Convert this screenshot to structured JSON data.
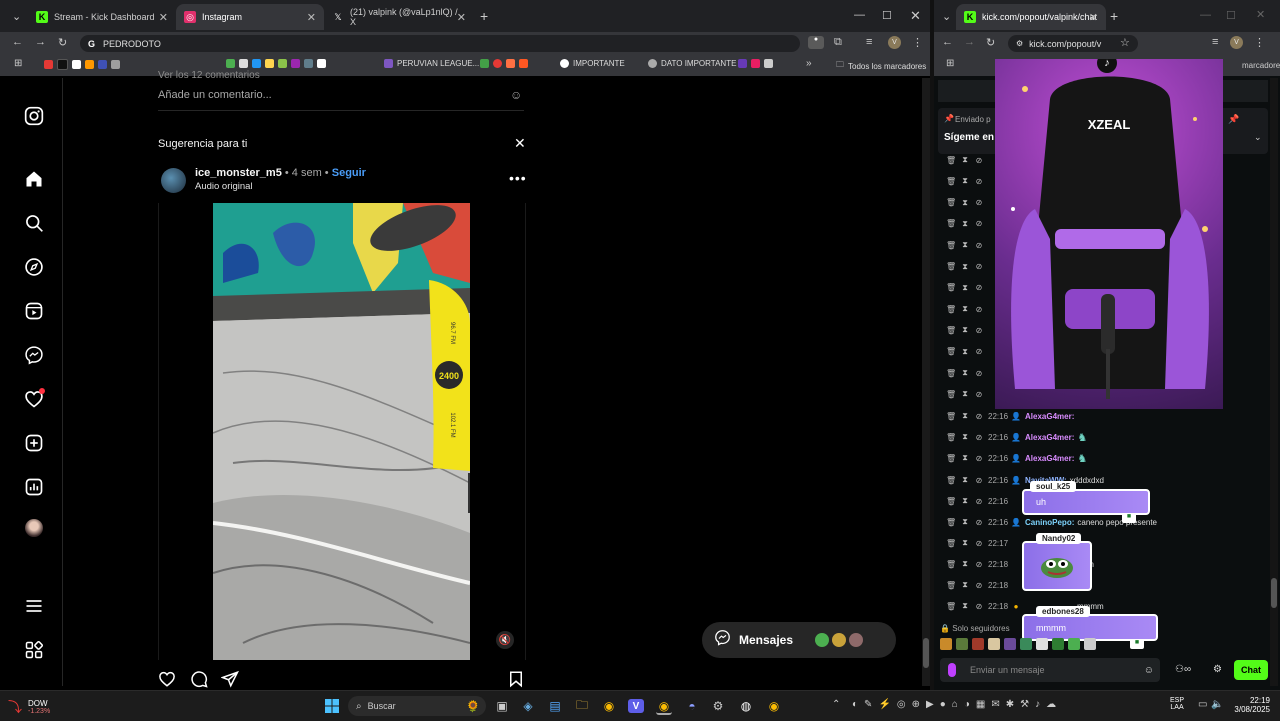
{
  "left_window": {
    "tabs": [
      {
        "label": "Stream - Kick Dashboard",
        "fav_color": "#53fc18",
        "fav": "K"
      },
      {
        "label": "Instagram",
        "fav_color": "#e1306c",
        "fav": "◎"
      },
      {
        "label": "(21) valpink (@vaLp1nlQ) / X",
        "fav_color": "#ffffff",
        "fav": "𝕏"
      }
    ],
    "address": "PEDRODOTO",
    "bookmarks": {
      "peruvian": "PERUVIAN LEAGUE...",
      "importante": "IMPORTANTE",
      "dato": "DATO IMPORTANTE",
      "all": "Todos los marcadores"
    }
  },
  "right_window": {
    "tab_label": "kick.com/popout/valpink/chat",
    "address": "kick.com/popout/v",
    "bookmark_tail": "marcadores"
  },
  "instagram": {
    "comment_count_partial": "Ver los 12 comentarios",
    "comment_placeholder": "Añade un comentario...",
    "suggestion_title": "Sugerencia para ti",
    "username": "ice_monster_m5",
    "time": "• 4 sem •",
    "follow": "Seguir",
    "audio": "Audio original",
    "messages": "Mensajes",
    "banner_text_1": "96.7 FM",
    "banner_text_2": "102.1 FM"
  },
  "chat": {
    "pinned_label": "Enviado p",
    "pinned_text": "Sígeme en",
    "rows": [
      {
        "time": "22:16",
        "user": "AlexaG4mer:",
        "color": "#d98cff",
        "msg": ""
      },
      {
        "time": "22:16",
        "user": "AlexaG4mer:",
        "color": "#d98cff",
        "msg": ""
      },
      {
        "time": "22:16",
        "user": "NayitaWW:",
        "color": "#8fb4ff",
        "msg": "xdddxdxd"
      },
      {
        "time": "22:16",
        "user": "",
        "color": "#ffffff",
        "msg": ""
      },
      {
        "time": "22:16",
        "user": "CaninoPepo:",
        "color": "#7dd3fc",
        "msg": "caneno pepo presente"
      },
      {
        "time": "22:17",
        "user": "",
        "color": "#ffffff",
        "msg": ""
      },
      {
        "time": "22:18",
        "user": "",
        "color": "#ffffff",
        "msg": "uh"
      },
      {
        "time": "22:18",
        "user": "",
        "color": "#ffffff",
        "msg": ""
      },
      {
        "time": "22:18",
        "user": "",
        "color": "#ffffff",
        "msg": "mmmm"
      }
    ],
    "alerts": [
      {
        "name": "soul_k25",
        "msg": "uh"
      },
      {
        "name": "Nandy02",
        "msg": ""
      },
      {
        "name": "edbones28",
        "msg": "mmmm"
      }
    ],
    "followers_only": "Solo seguidores",
    "input_placeholder": "Enviar un mensaje",
    "chat_button": "Chat",
    "chair_brand": "XZEAL"
  },
  "taskbar": {
    "ticker_name": "DOW",
    "ticker_value": "-1.23%",
    "search": "Buscar",
    "lang": "ESP",
    "lang_sub": "LAA",
    "time": "22:19",
    "date": "3/08/2025"
  }
}
